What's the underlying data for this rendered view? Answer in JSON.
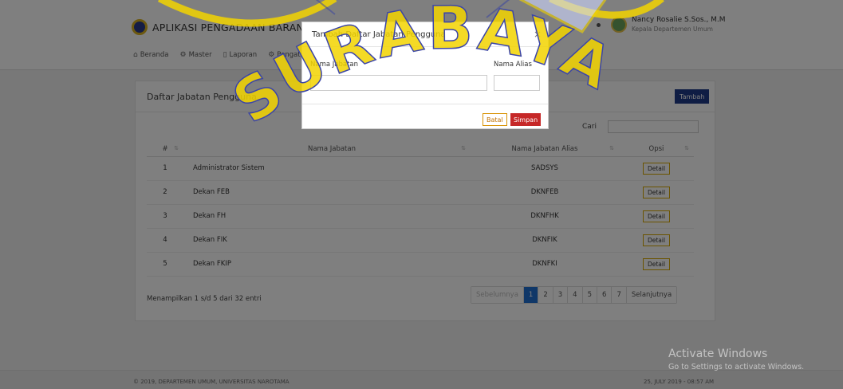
{
  "app": {
    "title": "APLIKASI PENGADAAN BARANG & JASA"
  },
  "user": {
    "name": "Nancy Rosalie S.Sos., M.M",
    "role": "Kepala Departemen Umum"
  },
  "nav": [
    {
      "icon": "home-icon",
      "glyph": "⌂",
      "label": "Beranda"
    },
    {
      "icon": "settings-icon",
      "glyph": "⚙",
      "label": "Master"
    },
    {
      "icon": "document-icon",
      "glyph": "▯",
      "label": "Laporan"
    },
    {
      "icon": "settings-icon",
      "glyph": "⚙",
      "label": "Pengaturan"
    }
  ],
  "card": {
    "title": "Daftar Jabatan Pengguna",
    "add_button": "Tambah",
    "search_label": "Cari",
    "columns": [
      "#",
      "Nama Jabatan",
      "Nama Jabatan Alias",
      "Opsi"
    ],
    "rows": [
      {
        "no": "1",
        "name": "Administrator Sistem",
        "alias": "SADSYS",
        "action": "Detail"
      },
      {
        "no": "2",
        "name": "Dekan FEB",
        "alias": "DKNFEB",
        "action": "Detail"
      },
      {
        "no": "3",
        "name": "Dekan FH",
        "alias": "DKNFHK",
        "action": "Detail"
      },
      {
        "no": "4",
        "name": "Dekan FIK",
        "alias": "DKNFIK",
        "action": "Detail"
      },
      {
        "no": "5",
        "name": "Dekan FKIP",
        "alias": "DKNFKI",
        "action": "Detail"
      }
    ],
    "info": "Menampilkan 1 s/d 5 dari 32 entri",
    "pagination": {
      "prev": "Sebelumnya",
      "pages": [
        "1",
        "2",
        "3",
        "4",
        "5",
        "6",
        "7"
      ],
      "active": "1",
      "next": "Selanjutnya"
    }
  },
  "modal": {
    "title": "Tambah Daftar Jabatan Pengguna",
    "close": "×",
    "field1_label": "Nama Jabatan",
    "field2_label": "Nama Alias",
    "cancel": "Batal",
    "save": "Simpan"
  },
  "footer": {
    "left": "© 2019, DEPARTEMEN UMUM, UNIVERSITAS NAROTAMA",
    "right": "25, JULY 2019 - 08:57 AM"
  },
  "watermark": {
    "activate_title": "Activate Windows",
    "activate_sub": "Go to Settings to activate Windows.",
    "logo_text": "SURABAYA"
  },
  "colors": {
    "primary": "#1f3a88",
    "pager_active": "#1f6fd0",
    "save": "#c62828",
    "detail_border": "#d6a800",
    "watermark_logo": "#f2d400"
  }
}
